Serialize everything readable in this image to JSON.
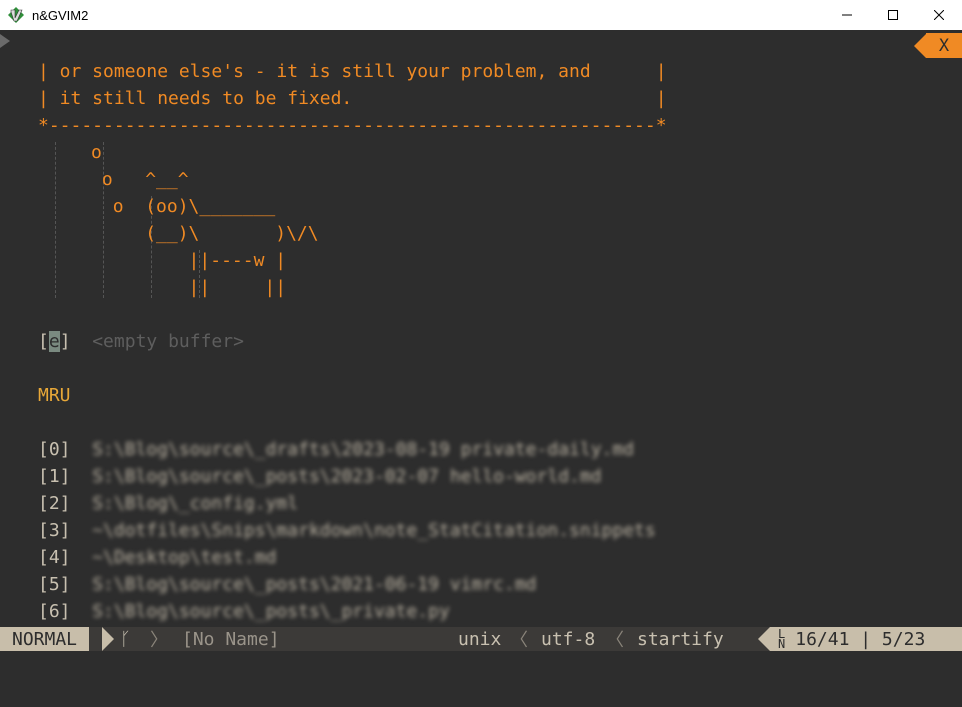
{
  "window": {
    "title": "n&GVIM2",
    "minimize_glyph": "—",
    "maximize_glyph": "☐",
    "close_glyph": "✕"
  },
  "tabline": {
    "close_label": "X"
  },
  "cowsay": {
    "lines": [
      "| or someone else's - it is still your problem, and      |",
      "| it still needs to be fixed.                            |",
      "*--------------------------------------------------------*"
    ],
    "cow": [
      "      o",
      "       o   ^__^",
      "        o  (oo)\\_______",
      "           (__)\\       )\\/\\",
      "               ||----w |",
      "               ||     ||"
    ]
  },
  "buffer": {
    "bracket_open": "[",
    "key": "e",
    "bracket_close": "]",
    "label": "<empty buffer>"
  },
  "mru": {
    "title": "MRU",
    "items": [
      {
        "key": "[0]",
        "path": "S:\\Blog\\source\\_drafts\\2023-08-19 private-daily.md"
      },
      {
        "key": "[1]",
        "path": "S:\\Blog\\source\\_posts\\2023-02-07 hello-world.md"
      },
      {
        "key": "[2]",
        "path": "S:\\Blog\\_config.yml"
      },
      {
        "key": "[3]",
        "path": "~\\dotfiles\\Snips\\markdown\\note_StatCitation.snippets"
      },
      {
        "key": "[4]",
        "path": "~\\Desktop\\test.md"
      },
      {
        "key": "[5]",
        "path": "S:\\Blog\\source\\_posts\\2021-06-19 vimrc.md"
      },
      {
        "key": "[6]",
        "path": "S:\\Blog\\source\\_posts\\_private.py"
      }
    ]
  },
  "statusline": {
    "mode": "NORMAL",
    "branch_icon": "ᚴ",
    "sep_right": "〉",
    "filename": "[No Name]",
    "fileformat": "unix",
    "sep_left": "〈",
    "encoding": "utf-8",
    "filetype": "startify",
    "ln_icon_top": "L",
    "ln_icon_bottom": "N",
    "position": "16/41 | 5/23"
  }
}
